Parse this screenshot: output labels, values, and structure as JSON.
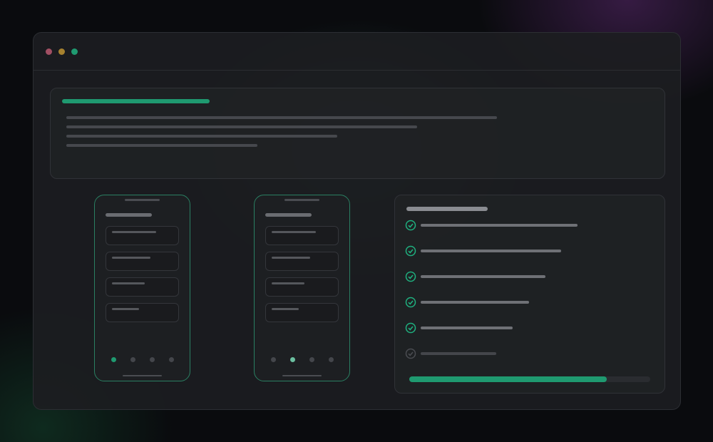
{
  "window": {
    "traffic_lights": [
      "close",
      "minimize",
      "maximize"
    ],
    "colors": {
      "close": "#a14f63",
      "minimize": "#a6812f",
      "maximize": "#1f9a70"
    }
  },
  "theme": {
    "accent": "#1f9a70",
    "panel_border": "#303237",
    "phone_border": "#2a7f62"
  },
  "hero": {
    "title_placeholder": "",
    "text_line_count": 4
  },
  "phones": [
    {
      "name": "phone-a",
      "card_count": 4,
      "page_dots": 4,
      "active_dot_index": 0,
      "arrow": "download-arrow-icon"
    },
    {
      "name": "phone-b",
      "card_count": 4,
      "page_dots": 4,
      "active_dot_index": 1,
      "arrow": "download-arrow-icon"
    }
  ],
  "checklist": {
    "items": [
      {
        "status": "done",
        "icon": "check-circle-icon"
      },
      {
        "status": "done",
        "icon": "check-circle-icon"
      },
      {
        "status": "done",
        "icon": "check-circle-icon"
      },
      {
        "status": "done",
        "icon": "check-circle-icon"
      },
      {
        "status": "done",
        "icon": "check-circle-icon"
      },
      {
        "status": "pending",
        "icon": "check-circle-outline-icon"
      }
    ],
    "progress": 0.82
  }
}
